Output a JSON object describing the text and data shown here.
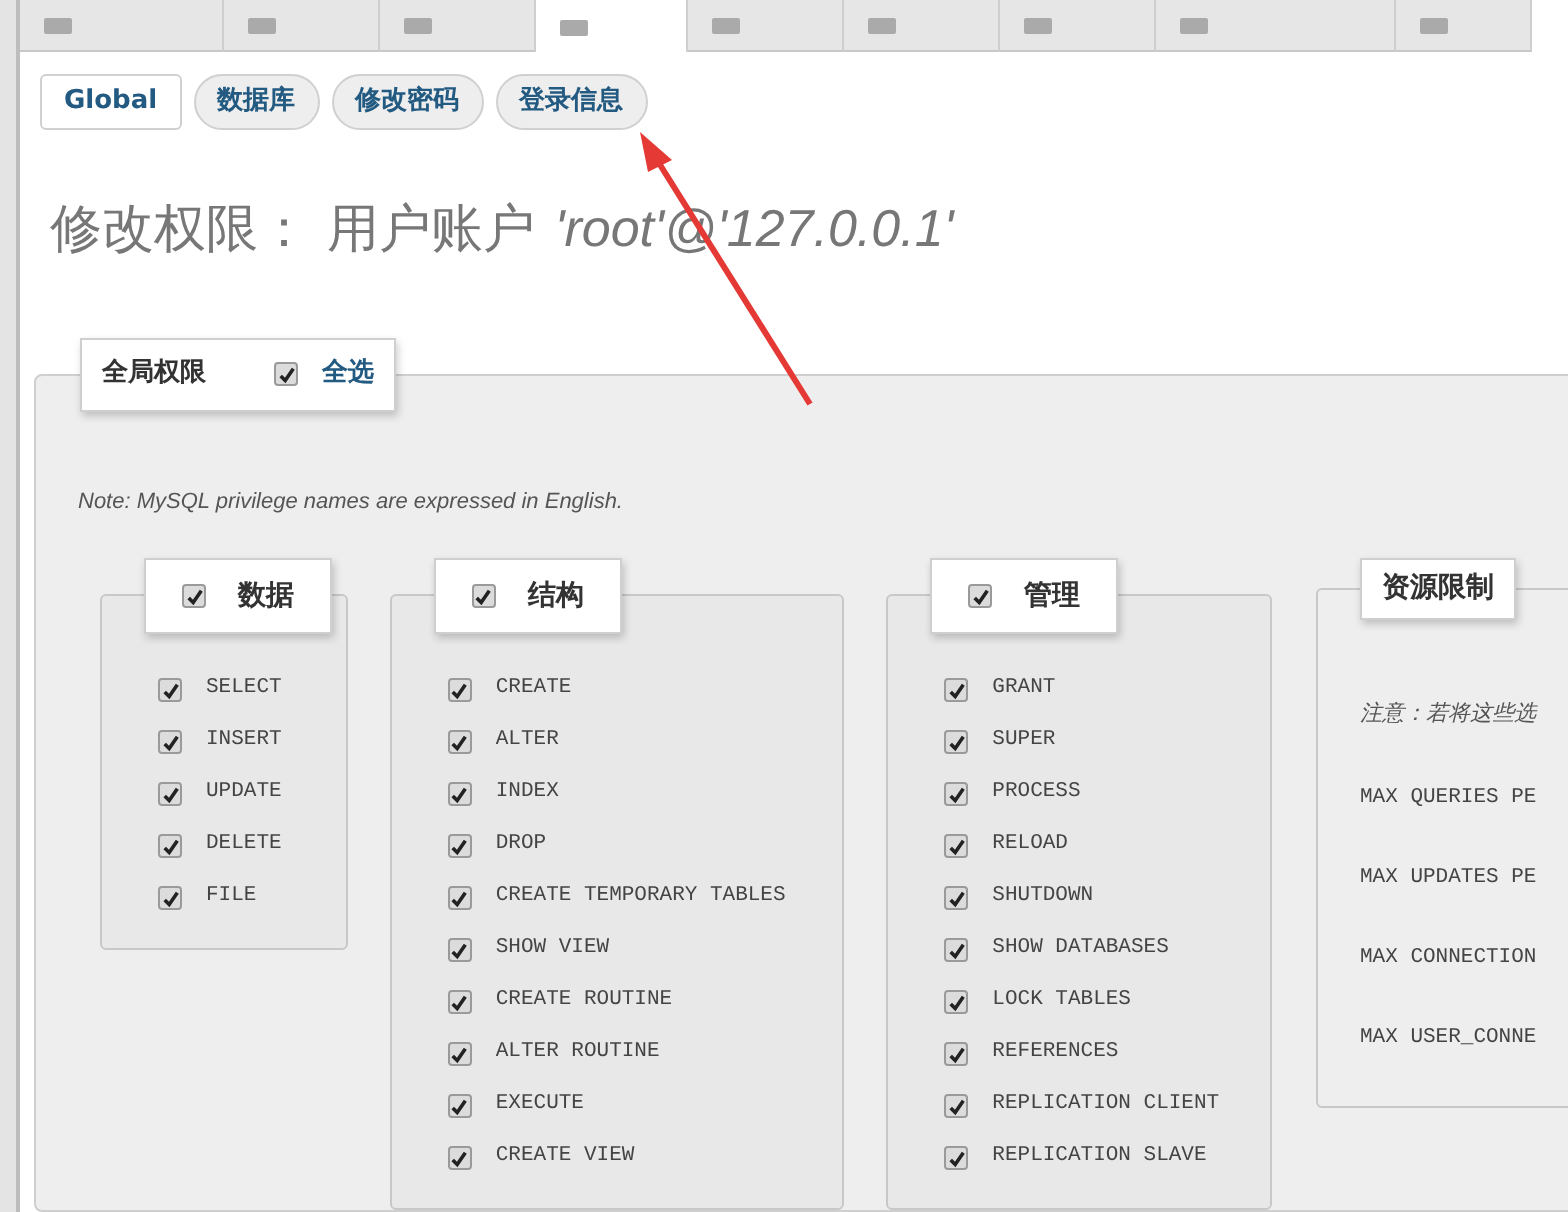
{
  "tabs": [
    {
      "selected": false
    },
    {
      "selected": false
    },
    {
      "selected": false
    },
    {
      "selected": true
    },
    {
      "selected": false
    },
    {
      "selected": false
    },
    {
      "selected": false
    },
    {
      "selected": false
    },
    {
      "selected": false
    }
  ],
  "subtabs": [
    {
      "label": "Global",
      "selected": true
    },
    {
      "label": "数据库",
      "selected": false
    },
    {
      "label": "修改密码",
      "selected": false
    },
    {
      "label": "登录信息",
      "selected": false
    }
  ],
  "heading": {
    "prefix": "修改权限： 用户账户",
    "account": "'root'@'127.0.0.1'"
  },
  "global": {
    "legend": "全局权限",
    "select_all": {
      "label": "全选",
      "checked": true
    }
  },
  "note": "Note: MySQL privilege names are expressed in English.",
  "groups": [
    {
      "title": "数据",
      "checked": true,
      "items": [
        {
          "label": "SELECT",
          "checked": true
        },
        {
          "label": "INSERT",
          "checked": true
        },
        {
          "label": "UPDATE",
          "checked": true
        },
        {
          "label": "DELETE",
          "checked": true
        },
        {
          "label": "FILE",
          "checked": true
        }
      ]
    },
    {
      "title": "结构",
      "checked": true,
      "items": [
        {
          "label": "CREATE",
          "checked": true
        },
        {
          "label": "ALTER",
          "checked": true
        },
        {
          "label": "INDEX",
          "checked": true
        },
        {
          "label": "DROP",
          "checked": true
        },
        {
          "label": "CREATE TEMPORARY TABLES",
          "checked": true
        },
        {
          "label": "SHOW VIEW",
          "checked": true
        },
        {
          "label": "CREATE ROUTINE",
          "checked": true
        },
        {
          "label": "ALTER ROUTINE",
          "checked": true
        },
        {
          "label": "EXECUTE",
          "checked": true
        },
        {
          "label": "CREATE VIEW",
          "checked": true
        }
      ]
    },
    {
      "title": "管理",
      "checked": true,
      "items": [
        {
          "label": "GRANT",
          "checked": true
        },
        {
          "label": "SUPER",
          "checked": true
        },
        {
          "label": "PROCESS",
          "checked": true
        },
        {
          "label": "RELOAD",
          "checked": true
        },
        {
          "label": "SHUTDOWN",
          "checked": true
        },
        {
          "label": "SHOW DATABASES",
          "checked": true
        },
        {
          "label": "LOCK TABLES",
          "checked": true
        },
        {
          "label": "REFERENCES",
          "checked": true
        },
        {
          "label": "REPLICATION CLIENT",
          "checked": true
        },
        {
          "label": "REPLICATION SLAVE",
          "checked": true
        }
      ]
    }
  ],
  "resources": {
    "title": "资源限制",
    "note": "注意：若将这些选",
    "limits": [
      "MAX QUERIES PE",
      "MAX UPDATES PE",
      "MAX CONNECTION",
      "MAX USER_CONNE"
    ]
  }
}
